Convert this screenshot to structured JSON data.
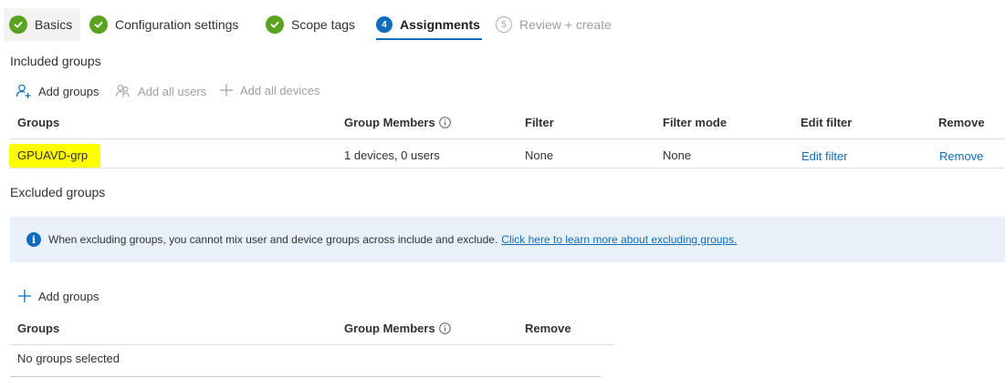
{
  "wizard": {
    "steps": [
      {
        "label": "Basics",
        "state": "done"
      },
      {
        "label": "Configuration settings",
        "state": "done"
      },
      {
        "label": "Scope tags",
        "state": "done"
      },
      {
        "label": "Assignments",
        "state": "active",
        "number": "4"
      },
      {
        "label": "Review + create",
        "state": "pending",
        "number": "5"
      }
    ]
  },
  "included": {
    "title": "Included groups",
    "commands": {
      "add_groups": "Add groups",
      "add_all_users": "Add all users",
      "add_all_devices": "Add all devices"
    },
    "columns": {
      "groups": "Groups",
      "group_members": "Group Members",
      "filter": "Filter",
      "filter_mode": "Filter mode",
      "edit_filter": "Edit filter",
      "remove": "Remove"
    },
    "rows": [
      {
        "group": "GPUAVD-grp",
        "members": "1 devices, 0 users",
        "filter": "None",
        "filter_mode": "None",
        "edit_filter": "Edit filter",
        "remove": "Remove"
      }
    ]
  },
  "excluded": {
    "title": "Excluded groups",
    "info": {
      "text": "When excluding groups, you cannot mix user and device groups across include and exclude.",
      "link": "Click here to learn more about excluding groups."
    },
    "commands": {
      "add_groups": "Add groups"
    },
    "columns": {
      "groups": "Groups",
      "group_members": "Group Members",
      "remove": "Remove"
    },
    "empty_text": "No groups selected"
  },
  "colors": {
    "accent": "#0f6cbd",
    "done": "#5aa320",
    "highlight": "#ffff00",
    "info_bg": "#e8f1fa"
  }
}
